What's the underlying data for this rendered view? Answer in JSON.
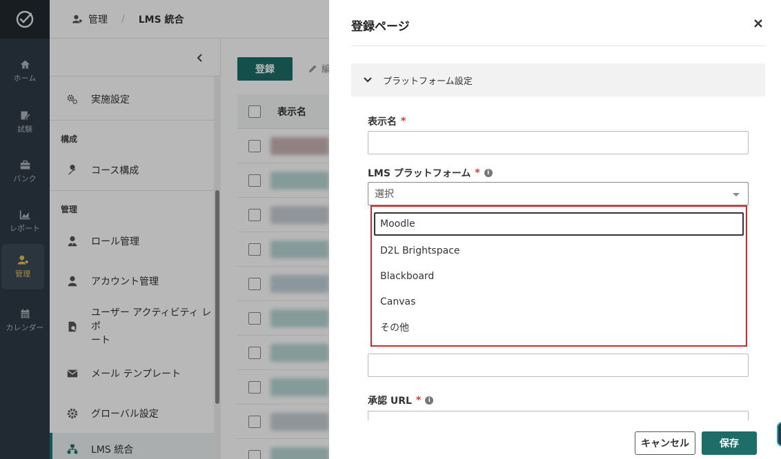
{
  "rail": {
    "items": [
      {
        "label": "ホーム",
        "icon": "home-icon"
      },
      {
        "label": "試験",
        "icon": "exam-icon"
      },
      {
        "label": "バンク",
        "icon": "bank-icon"
      },
      {
        "label": "レポート",
        "icon": "report-icon"
      },
      {
        "label": "管理",
        "icon": "admin-icon",
        "active": true
      },
      {
        "label": "カレンダー",
        "icon": "calendar-icon"
      }
    ]
  },
  "breadcrumb": {
    "parent": "管理",
    "current": "LMS 統合"
  },
  "sidenav": {
    "items": {
      "impl": "実施設定",
      "course": "コース構成",
      "role": "ロール管理",
      "account": "アカウント管理",
      "activity_line1": "ユーザー アクティビティ レポ",
      "activity_line2": "ート",
      "mail": "メール テンプレート",
      "global": "グローバル設定",
      "lms": "LMS 統合"
    },
    "groups": {
      "structure": "構成",
      "manage": "管理"
    }
  },
  "main": {
    "register_button": "登録",
    "edit_button": "編",
    "column_display_name": "表示名"
  },
  "drawer": {
    "title": "登録ページ",
    "section": "プラットフォーム設定",
    "display_name_label": "表示名",
    "display_name_value": "",
    "lms_platform_label": "LMS プラットフォーム",
    "select_placeholder": "選択",
    "options": [
      "Moodle",
      "D2L Brightspace",
      "Blackboard",
      "Canvas",
      "その他"
    ],
    "auth_url_label": "承認 URL",
    "required_mark": "*",
    "info_mark": "i",
    "cancel_button": "キャンセル",
    "save_button": "保存"
  },
  "colors": {
    "accent": "#1d6e69",
    "rail_bg": "#2f3b46",
    "rail_active_text": "#e8c25a",
    "highlight_border": "#d9252b"
  }
}
